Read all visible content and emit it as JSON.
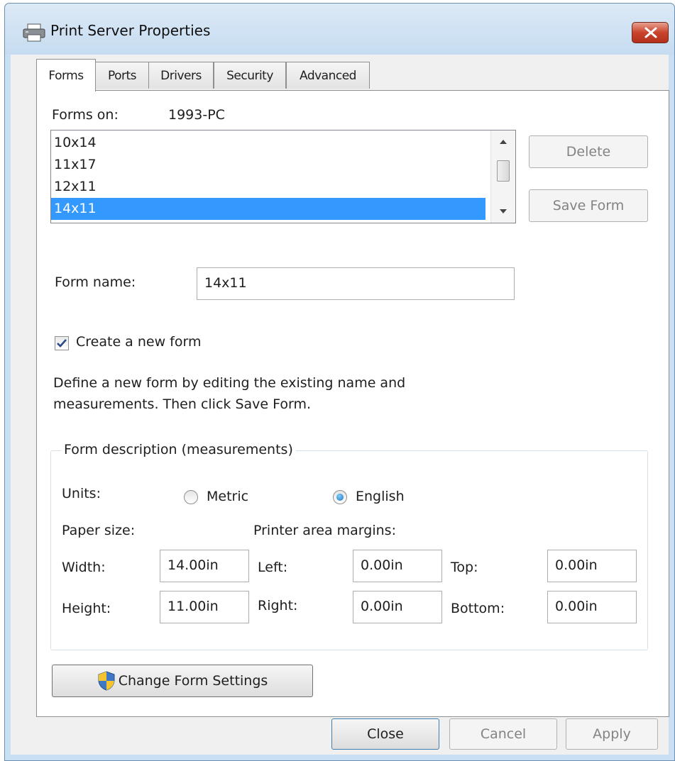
{
  "window": {
    "title": "Print Server Properties",
    "close_tooltip_glyph": "✕"
  },
  "tabs": [
    {
      "label": "Forms",
      "active": true
    },
    {
      "label": "Ports",
      "active": false
    },
    {
      "label": "Drivers",
      "active": false
    },
    {
      "label": "Security",
      "active": false
    },
    {
      "label": "Advanced",
      "active": false
    }
  ],
  "forms_tab": {
    "forms_on_label": "Forms on:",
    "forms_on_value": "1993-PC",
    "forms_list": [
      "10x14",
      "11x17",
      "12x11",
      "14x11"
    ],
    "selected_form": "14x11",
    "delete_button": "Delete",
    "save_form_button": "Save Form",
    "form_name_label": "Form name:",
    "form_name_value": "14x11",
    "create_new_form_label": "Create a new form",
    "create_new_form_checked": true,
    "description_line1": "Define a new form by editing the existing name and",
    "description_line2": "measurements. Then click Save Form.",
    "group_title": "Form description (measurements)",
    "units_label": "Units:",
    "units_options": [
      "Metric",
      "English"
    ],
    "units_selected": "English",
    "paper_size_label": "Paper size:",
    "margins_label": "Printer area margins:",
    "width_label": "Width:",
    "width_value": "14.00in",
    "height_label": "Height:",
    "height_value": "11.00in",
    "left_label": "Left:",
    "left_value": "0.00in",
    "right_label": "Right:",
    "right_value": "0.00in",
    "top_label": "Top:",
    "top_value": "0.00in",
    "bottom_label": "Bottom:",
    "bottom_value": "0.00in",
    "change_settings_button": "Change Form Settings"
  },
  "footer": {
    "close_button": "Close",
    "cancel_button": "Cancel",
    "apply_button": "Apply"
  },
  "colors": {
    "selection": "#3399ff",
    "title_close": "#c9432c",
    "window_frame": "#c9dff2"
  },
  "icons": {
    "title": "printer-icon",
    "change_settings": "uac-shield-icon",
    "scroll_up": "scroll-up-arrow-icon",
    "scroll_down": "scroll-down-arrow-icon"
  }
}
